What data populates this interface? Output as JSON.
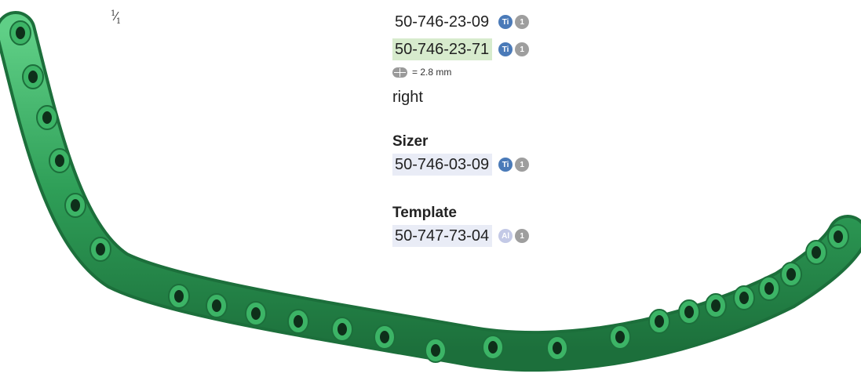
{
  "scale": {
    "num": "1",
    "den": "1"
  },
  "articles": [
    {
      "number": "50-746-23-09",
      "material": "Ti",
      "qty": "1",
      "highlight": "none"
    },
    {
      "number": "50-746-23-71",
      "material": "Ti",
      "qty": "1",
      "highlight": "green"
    }
  ],
  "thickness": {
    "icon": "plate-thickness-icon",
    "text": "= 2.8 mm"
  },
  "side": "right",
  "sizer": {
    "heading": "Sizer",
    "number": "50-746-03-09",
    "material": "Ti",
    "qty": "1"
  },
  "template": {
    "heading": "Template",
    "number": "50-747-73-04",
    "material": "Al",
    "qty": "1"
  },
  "colors": {
    "implant": "#2e9e57",
    "implant_dark": "#1c6f3b",
    "badge_ti": "#4a7ab8",
    "badge_al": "#c3c9e6",
    "badge_qty": "#9e9e9e"
  }
}
